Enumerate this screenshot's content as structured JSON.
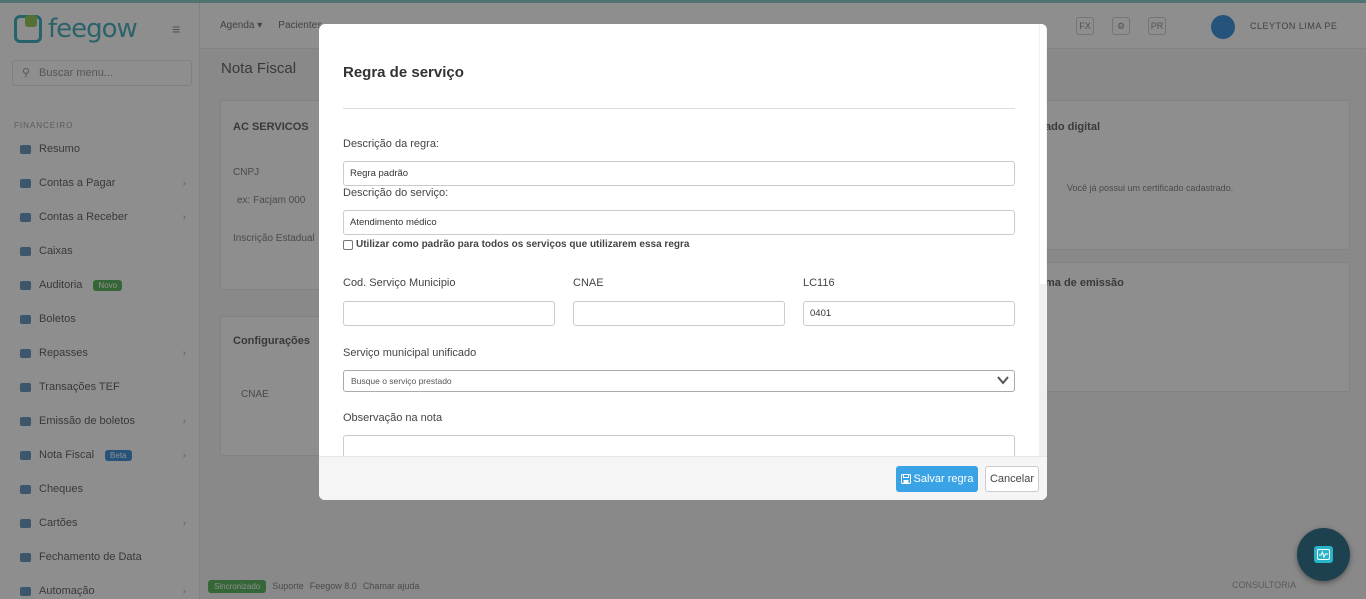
{
  "app": {
    "logo_text": "feegow",
    "search_placeholder": "Buscar menu...",
    "section_label": "FINANCEIRO",
    "topnav": [
      "Agenda ▾",
      "Pacientes"
    ],
    "topnav_icons": [
      "FX",
      "⚙",
      "PR"
    ],
    "user_name": "CLEYTON LIMA PE",
    "page_title": "Nota Fiscal",
    "sidebar": [
      {
        "label": "Resumo",
        "chevron": false,
        "badge": ""
      },
      {
        "label": "Contas a Pagar",
        "chevron": true,
        "badge": ""
      },
      {
        "label": "Contas a Receber",
        "chevron": true,
        "badge": ""
      },
      {
        "label": "Caixas",
        "chevron": false,
        "badge": ""
      },
      {
        "label": "Auditoria",
        "chevron": false,
        "badge": "Novo"
      },
      {
        "label": "Boletos",
        "chevron": false,
        "badge": ""
      },
      {
        "label": "Repasses",
        "chevron": true,
        "badge": ""
      },
      {
        "label": "Transações TEF",
        "chevron": false,
        "badge": ""
      },
      {
        "label": "Emissão de boletos",
        "chevron": true,
        "badge": ""
      },
      {
        "label": "Nota Fiscal",
        "chevron": true,
        "badge": "Beta"
      },
      {
        "label": "Cheques",
        "chevron": false,
        "badge": ""
      },
      {
        "label": "Cartões",
        "chevron": true,
        "badge": ""
      },
      {
        "label": "Fechamento de Data",
        "chevron": false,
        "badge": ""
      },
      {
        "label": "Automação",
        "chevron": true,
        "badge": ""
      }
    ],
    "panels": {
      "left_title": "AC SERVICOS",
      "left_field1": "CNPJ",
      "left_value1": "ex: Facjam 000",
      "left_field2": "Inscrição Estadual",
      "left_title2": "Configurações",
      "left_field3": "CNAE",
      "right_title": "ado digital",
      "right_text": "Você já possui um certificado cadastrado.",
      "right_title2": "ma de emissão"
    },
    "footer": {
      "badge": "Sincronizado",
      "text1": "Suporte",
      "text2": "Feegow 8.0",
      "text3": "Chamar ajuda",
      "right": "CONSULTORIA"
    }
  },
  "modal": {
    "title": "Regra de serviço",
    "rule_description_label": "Descrição da regra:",
    "rule_description_value": "Regra padrão",
    "service_description_label": "Descrição do serviço:",
    "service_description_value": "Atendimento médico",
    "default_checkbox_label": "Utilizar como padrão para todos os serviços que utilizarem essa regra",
    "default_checkbox_checked": false,
    "municipal_code_label": "Cod. Serviço Municipio",
    "municipal_code_value": "",
    "cnae_label": "CNAE",
    "cnae_value": "",
    "lc116_label": "LC116",
    "lc116_value": "0401",
    "unified_service_label": "Serviço municipal unificado",
    "unified_service_placeholder": "Busque o serviço prestado",
    "note_label": "Observação na nota",
    "note_value": "",
    "save_button": "Salvar regra",
    "cancel_button": "Cancelar"
  },
  "colors": {
    "primary_button": "#39a3e6",
    "chat_fab": "#1e4150",
    "chat_fab_icon": "#29b5c9"
  },
  "icons": [
    "search-icon",
    "menu-icon",
    "save-icon",
    "chevron-down-icon",
    "chat-icon"
  ]
}
